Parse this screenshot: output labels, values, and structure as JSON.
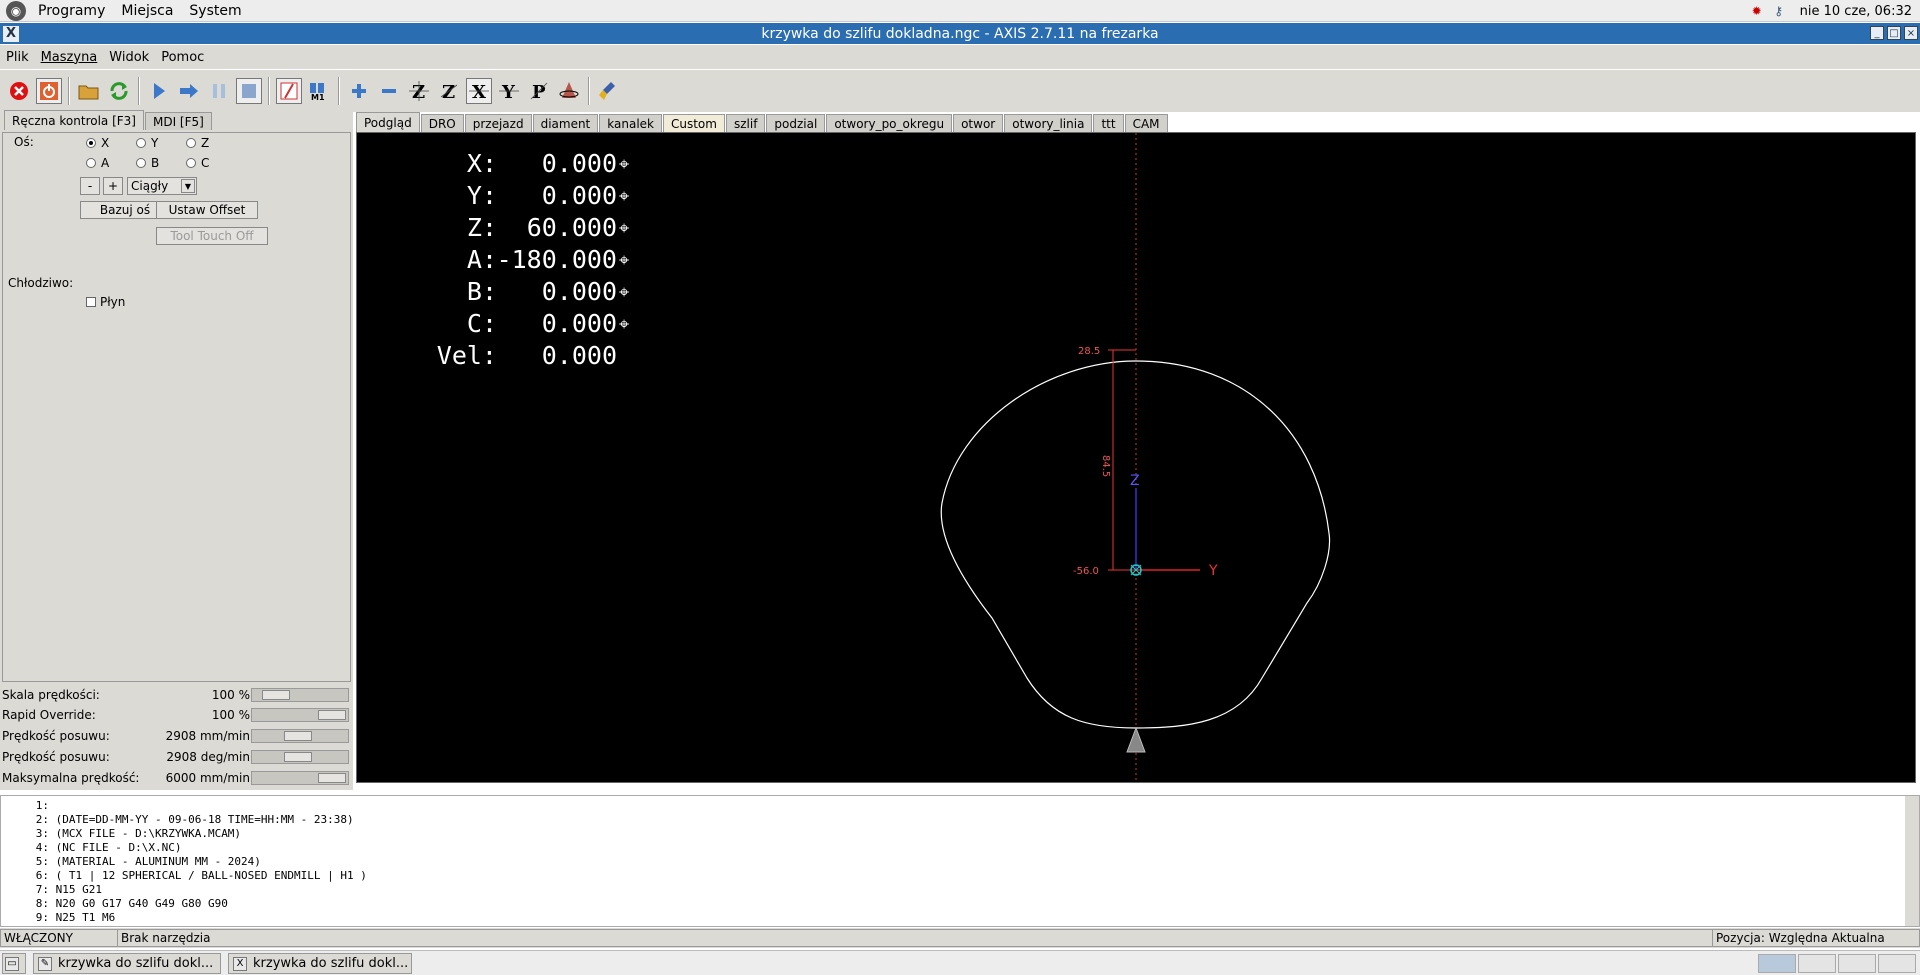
{
  "top_panel": {
    "menus": [
      "Programy",
      "Miejsca",
      "System"
    ],
    "clock": "nie 10 cze, 06:32"
  },
  "window": {
    "title": "krzywka do szlifu dokladna.ngc - AXIS 2.7.11 na frezarka",
    "controls": [
      "_",
      "□",
      "×"
    ]
  },
  "menubar": [
    "Plik",
    "Maszyna",
    "Widok",
    "Pomoc"
  ],
  "toolbar": {
    "icons": [
      "estop-icon",
      "power-icon",
      "open-file-icon",
      "reload-icon",
      "run-icon",
      "step-icon",
      "pause-icon",
      "stop-icon",
      "block-delete-icon",
      "optional-stop-icon",
      "zoom-in-icon",
      "zoom-out-icon",
      "view-z-icon",
      "view-z2-icon",
      "view-x-icon",
      "view-y-icon",
      "view-p-icon",
      "rotate-icon",
      "clear-plot-icon"
    ]
  },
  "left_tabs": [
    "Ręczna kontrola [F3]",
    "MDI [F5]"
  ],
  "manual": {
    "axis_label": "Oś:",
    "axes": [
      "X",
      "Y",
      "Z",
      "A",
      "B",
      "C"
    ],
    "selected_axis": "X",
    "minus": "-",
    "plus": "+",
    "jog_mode": "Ciągły",
    "home_button": "Bazuj oś",
    "offset_button": "Ustaw Offset",
    "tool_touch_off": "Tool Touch Off",
    "coolant_label": "Chłodziwo:",
    "flood_label": "Płyn"
  },
  "sliders": [
    {
      "name": "Skala prędkości:",
      "value": "100 %",
      "position": 0.15
    },
    {
      "name": "Rapid Override:",
      "value": "100 %",
      "position": 1.0
    },
    {
      "name": "Prędkość posuwu:",
      "value": "2908 mm/min",
      "position": 0.48
    },
    {
      "name": "Prędkość posuwu:",
      "value": "2908 deg/min",
      "position": 0.48
    },
    {
      "name": "Maksymalna prędkość:",
      "value": "6000 mm/min",
      "position": 1.0
    }
  ],
  "preview_tabs": [
    "Podgląd",
    "DRO",
    "przejazd",
    "diament",
    "kanalek",
    "Custom",
    "szlif",
    "podzial",
    "otwory_po_okregu",
    "otwor",
    "otwory_linia",
    "ttt",
    "CAM"
  ],
  "dro": [
    {
      "label": "X:",
      "value": "0.000"
    },
    {
      "label": "Y:",
      "value": "0.000"
    },
    {
      "label": "Z:",
      "value": "60.000"
    },
    {
      "label": "A:",
      "value": "-180.000"
    },
    {
      "label": "B:",
      "value": "0.000"
    },
    {
      "label": "C:",
      "value": "0.000"
    },
    {
      "label": "Vel:",
      "value": "0.000"
    }
  ],
  "plot": {
    "dim_top": "28.5",
    "dim_bottom": "-56.0",
    "dim_length": "84.5",
    "axis_z": "Z",
    "axis_y": "Y"
  },
  "gcode": [
    {
      "n": "1:",
      "text": ""
    },
    {
      "n": "2:",
      "text": "(DATE=DD-MM-YY - 09-06-18 TIME=HH:MM - 23:38)"
    },
    {
      "n": "3:",
      "text": "(MCX FILE - D:\\KRZYWKA.MCAM)"
    },
    {
      "n": "4:",
      "text": "(NC FILE - D:\\X.NC)"
    },
    {
      "n": "5:",
      "text": "(MATERIAL - ALUMINUM MM - 2024)"
    },
    {
      "n": "6:",
      "text": "( T1 | 12 SPHERICAL / BALL-NOSED ENDMILL | H1 )"
    },
    {
      "n": "7:",
      "text": "N15 G21"
    },
    {
      "n": "8:",
      "text": "N20 G0 G17 G40 G49 G80 G90"
    },
    {
      "n": "9:",
      "text": "N25 T1 M6"
    }
  ],
  "status": {
    "machine": "WŁĄCZONY",
    "tool": "Brak narzędzia",
    "position": "Pozycja: Względna Aktualna"
  },
  "taskbar": [
    {
      "label": "krzywka do szlifu dokl...",
      "icon": "editor-icon"
    },
    {
      "label": "krzywka do szlifu dokl...",
      "icon": "x-app-icon"
    }
  ]
}
